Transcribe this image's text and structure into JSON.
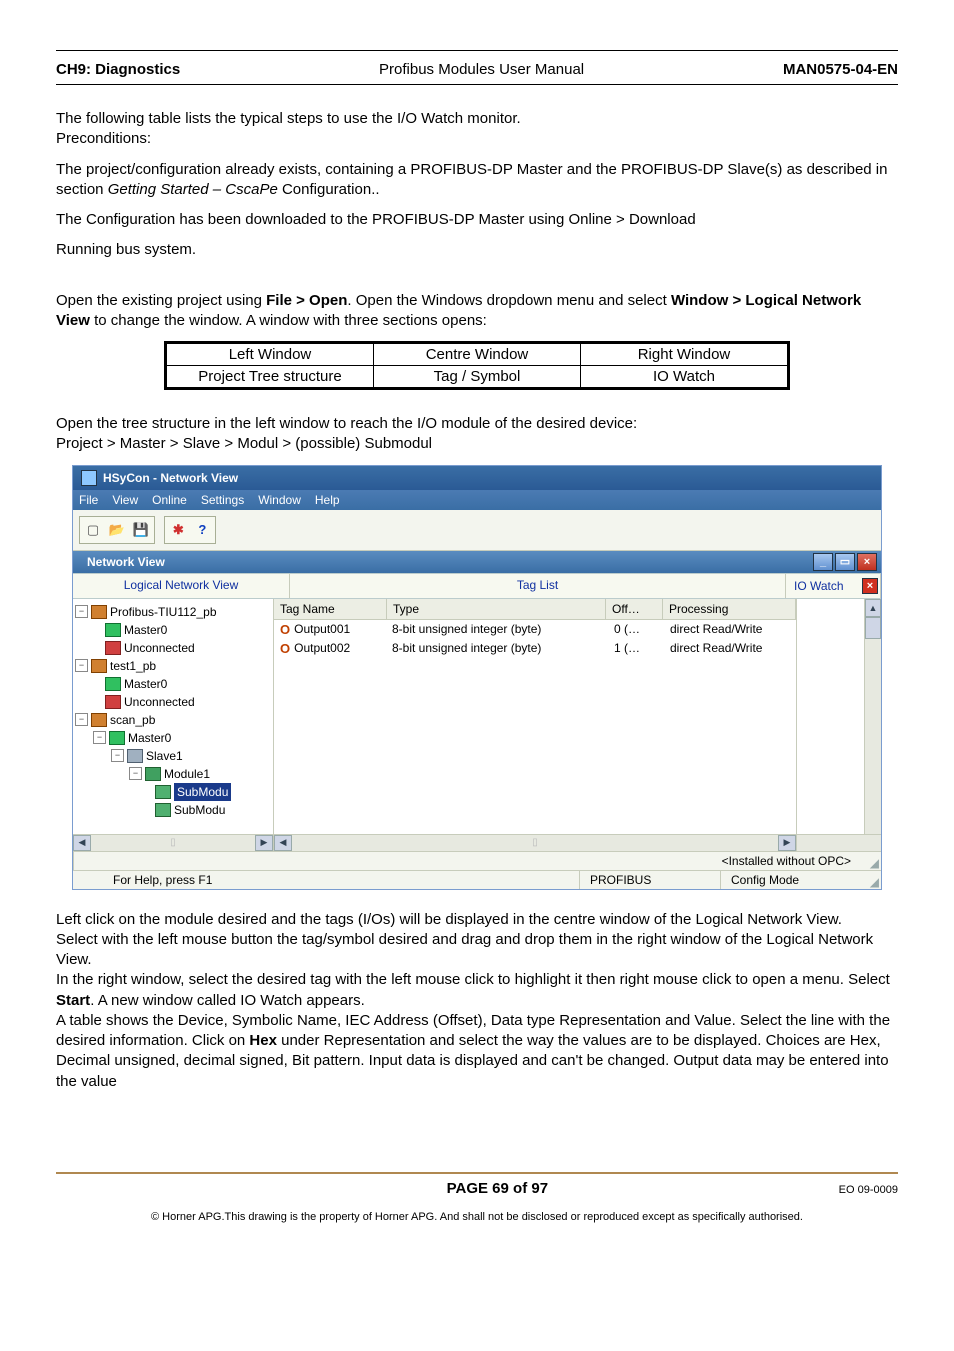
{
  "header": {
    "left": "CH9: Diagnostics",
    "center": "Profibus Modules User Manual",
    "right": "MAN0575-04-EN"
  },
  "para1a": "The following table lists the typical steps to use the I/O Watch monitor.",
  "para1b": "Preconditions:",
  "para2a": "The project/configuration already exists, containing a PROFIBUS-DP Master and the PROFIBUS-DP Slave(s) as described in section ",
  "para2b_em": "Getting Started – CscaPe",
  "para2c": " Configuration..",
  "para3": "The Configuration has been downloaded to the PROFIBUS-DP Master using Online > Download",
  "para4": "Running bus system.",
  "para5_pre": "Open the existing project using ",
  "para5_b1": "File > Open",
  "para5_mid": ".  Open the Windows dropdown menu and select ",
  "para5_b2": "Window > Logical Network View",
  "para5_post": " to change the window.  A window with three sections opens:",
  "table3": {
    "r1": {
      "c1": "Left Window",
      "c2": "Centre Window",
      "c3": "Right Window"
    },
    "r2": {
      "c1": "Project Tree structure",
      "c2": "Tag / Symbol",
      "c3": "IO Watch"
    }
  },
  "para6a": "Open the tree structure in the left window to reach the I/O module of the desired device:",
  "para6b": "Project > Master > Slave > Modul > (possible) Submodul",
  "app": {
    "title": "HSyCon - Network View",
    "menu": {
      "file": "File",
      "view": "View",
      "online": "Online",
      "settings": "Settings",
      "window": "Window",
      "help": "Help"
    },
    "nv_title": "Network View",
    "cols": {
      "left": "Logical Network View",
      "mid": "Tag List",
      "right": "IO Watch"
    },
    "tree": {
      "n1": "Profibus-TIU112_pb",
      "n1a": "Master0",
      "n1b": "Unconnected",
      "n2": "test1_pb",
      "n2a": "Master0",
      "n2b": "Unconnected",
      "n3": "scan_pb",
      "n3a": "Master0",
      "n3a1": "Slave1",
      "n3a1a": "Module1",
      "n3a1a1": "SubModu",
      "n3a1a2": "SubModu"
    },
    "taghead": {
      "c1": "Tag Name",
      "c2": "Type",
      "c3": "Off…",
      "c4": "Processing"
    },
    "tagrows": [
      {
        "name": "Output001",
        "type": "8-bit unsigned integer (byte)",
        "off": "0  (…",
        "proc": "direct Read/Write"
      },
      {
        "name": "Output002",
        "type": "8-bit unsigned integer (byte)",
        "off": "1  (…",
        "proc": "direct Read/Write"
      }
    ],
    "status": {
      "opc": "<Installed without OPC>",
      "help": "For Help, press F1",
      "bus": "PROFIBUS",
      "mode": "Config Mode"
    }
  },
  "para7": "Left click on the module desired and the tags (I/Os) will be displayed in the centre window of the Logical Network View.",
  "para8": "Select with the left mouse button the tag/symbol desired and drag and drop them in the right window of the Logical Network View.",
  "para9_pre": "In the right window, select the desired tag with the left mouse click to highlight it then right mouse click to open a menu.  Select ",
  "para9_b": "Start",
  "para9_post": ".  A new window called IO Watch appears.",
  "para10_pre": "A table shows the Device, Symbolic Name, IEC Address (Offset), Data type Representation and Value. Select the line with the desired information.  Click on ",
  "para10_b": "Hex",
  "para10_post": " under Representation and select the way the values are to be displayed.  Choices are Hex, Decimal unsigned, decimal signed, Bit pattern.  Input data is displayed and can't be changed.  Output data may be entered into the value",
  "footer": {
    "center": "PAGE 69 of 97",
    "right": "EO 09-0009",
    "copy": "© Horner APG.This drawing is the property of Horner APG. And shall not be disclosed or reproduced except as specifically authorised."
  }
}
